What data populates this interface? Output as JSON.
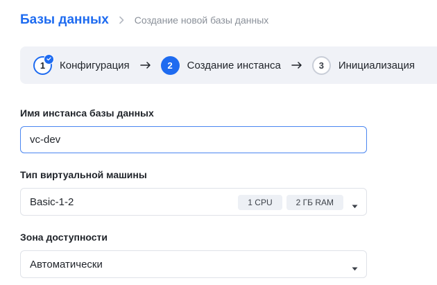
{
  "breadcrumb": {
    "root": "Базы данных",
    "current": "Создание новой базы данных"
  },
  "stepper": {
    "steps": [
      {
        "number": "1",
        "label": "Конфигурация",
        "state": "done"
      },
      {
        "number": "2",
        "label": "Создание инстанса",
        "state": "active"
      },
      {
        "number": "3",
        "label": "Инициализация",
        "state": "pending"
      }
    ]
  },
  "form": {
    "instance_name": {
      "label": "Имя инстанса базы данных",
      "value": "vc-dev"
    },
    "vm_type": {
      "label": "Тип виртуальной машины",
      "value": "Basic-1-2",
      "cpu": "1 CPU",
      "ram": "2 ГБ RAM"
    },
    "zone": {
      "label": "Зона доступности",
      "value": "Автоматически"
    }
  },
  "colors": {
    "accent": "#1e6bf0",
    "stepper_bg": "#f0f2f7",
    "muted_text": "#8a9099"
  }
}
